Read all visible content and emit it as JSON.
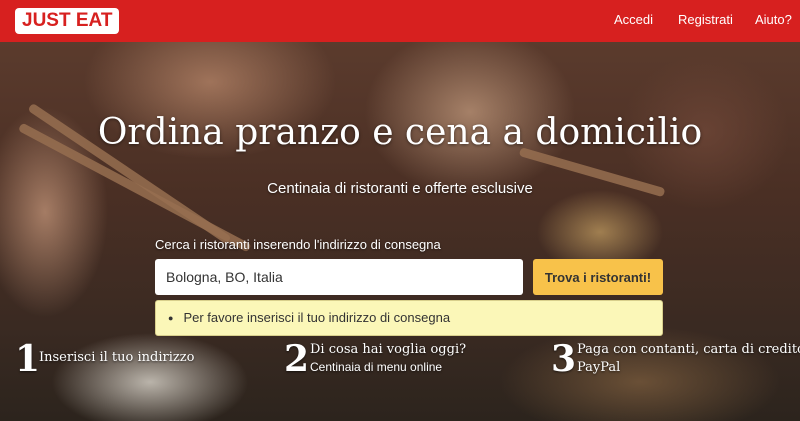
{
  "header": {
    "logo_text": "JUST EAT",
    "nav": {
      "login": "Accedi",
      "register": "Registrati",
      "help": "Aiuto?"
    }
  },
  "hero": {
    "title": "Ordina pranzo e cena a domicilio",
    "subtitle": "Centinaia di ristoranti e offerte esclusive"
  },
  "search": {
    "label": "Cerca i ristoranti inserendo l'indirizzo di consegna",
    "value": "Bologna, BO, Italia",
    "button_label": "Trova i ristoranti!",
    "error": "Per favore inserisci il tuo indirizzo di consegna"
  },
  "steps": [
    {
      "number": "1",
      "title": "Inserisci il tuo indirizzo",
      "subtitle": ""
    },
    {
      "number": "2",
      "title": "Di cosa hai voglia oggi?",
      "subtitle": "Centinaia di menu online"
    },
    {
      "number": "3",
      "title": "Paga con contanti, carta di credito o",
      "title2": "PayPal",
      "subtitle": ""
    }
  ],
  "colors": {
    "brand": "#d7201f",
    "button": "#f8c24a",
    "alert_bg": "#fbf7b8"
  }
}
